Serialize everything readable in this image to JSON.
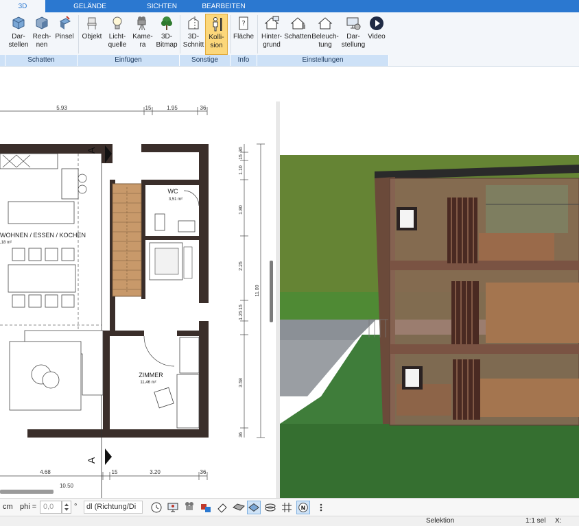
{
  "ribbon": {
    "tabs": [
      {
        "label": "3D",
        "active": true
      },
      {
        "label": "GELÄNDE",
        "active": false
      },
      {
        "label": "SICHTEN",
        "active": false
      },
      {
        "label": "BEARBEITEN",
        "active": false
      }
    ],
    "buttons": {
      "darstellen": "Dar-\nstellen",
      "rechnen": "Rech-\nnen",
      "pinsel": "Pinsel",
      "objekt": "Objekt",
      "lichtquelle": "Licht-\nquelle",
      "kamera": "Kame-\nra",
      "bitmap3d": "3D-\nBitmap",
      "schnitt3d": "3D-\nSchnitt",
      "kollision": "Kolli-\nsion",
      "flaeche": "Fläche",
      "hintergrund": "Hinter-\ngrund",
      "schatten": "Schatten",
      "beleuchtung": "Beleuch-\ntung",
      "darstellung": "Dar-\nstellung",
      "video": "Video"
    },
    "groups": {
      "schatten": "Schatten",
      "einfuegen": "Einfügen",
      "sonstige": "Sonstige",
      "info": "Info",
      "einstellungen": "Einstellungen"
    }
  },
  "plan": {
    "dims_top": [
      "5.93",
      "15",
      "1.95",
      "36"
    ],
    "dims_bottom": [
      "4.68",
      "15",
      "3.20",
      "36"
    ],
    "dim_bottom_total": "10.50",
    "dims_right": [
      "36",
      "15",
      "1.10",
      "1.80",
      "2.25",
      "15",
      "1.25",
      "3.58",
      "36"
    ],
    "dim_right_total": "11.00",
    "rooms": {
      "wc_name": "WC",
      "wc_area": "3,51 m²",
      "wohnen_name": "WOHNEN / ESSEN / KOCHEN",
      "wohnen_area": ",18 m²",
      "zimmer_name": "ZIMMER",
      "zimmer_area": "11,46 m²"
    },
    "section_marker": "A"
  },
  "bottombar": {
    "unit": "cm",
    "phi_label": "phi =",
    "phi_value": "0,0",
    "degree": "°",
    "direction_select": "dl (Richtung/Di"
  },
  "statusbar": {
    "mode": "Selektion",
    "selection": "1:1 sel",
    "x_label": "X:"
  },
  "colors": {
    "tab_bar": "#2b78d0",
    "ribbon_bg": "#f3f6fa",
    "group_label_bg": "#cde1f7",
    "active_button": "#fcd77a",
    "wall": "#3a2e2a",
    "stair": "#c8996a",
    "grass": "#3f7d3a"
  }
}
